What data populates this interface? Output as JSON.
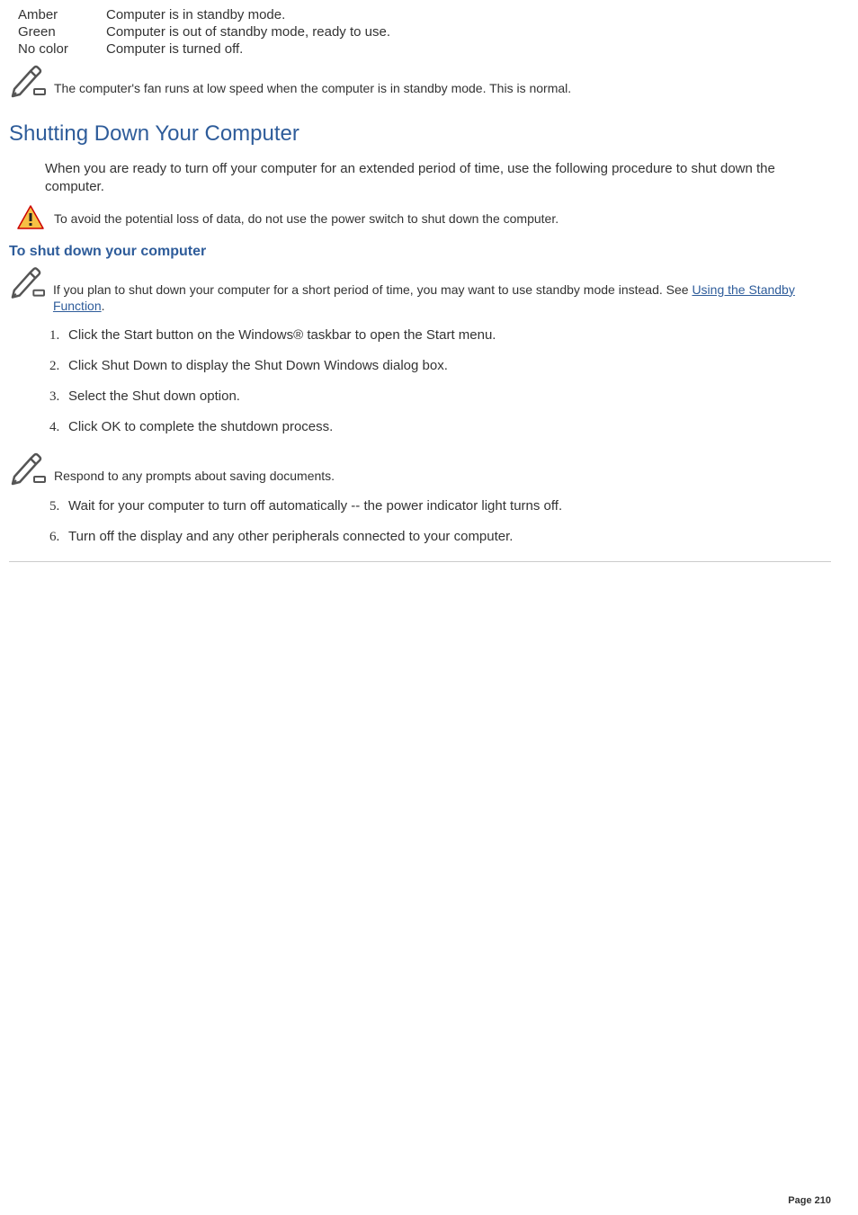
{
  "color_table": [
    {
      "label": "Amber",
      "desc": "Computer is in standby mode."
    },
    {
      "label": "Green",
      "desc": "Computer is out of standby mode, ready to use."
    },
    {
      "label": "No color",
      "desc": "Computer is turned off."
    }
  ],
  "note_top": "The computer's fan runs at low speed when the computer is in standby mode. This is normal.",
  "heading_main": "Shutting Down Your Computer",
  "intro": "When you are ready to turn off your computer for an extended period of time, use the following procedure to shut down the computer.",
  "warning": "To avoid the potential loss of data, do not use the power switch to shut down the computer.",
  "subheading": "To shut down your computer",
  "note_shutdown_a": "If you plan to shut down your computer for a short period of time, you may want to use standby mode instead. See ",
  "note_shutdown_link": "Using the Standby Function",
  "note_shutdown_b": ".",
  "steps_1_4": [
    "Click the Start button on the Windows® taskbar to open the Start menu.",
    "Click Shut Down to display the Shut Down Windows dialog box.",
    "Select the Shut down option.",
    "Click OK to complete the shutdown process."
  ],
  "note_mid": "Respond to any prompts about saving documents.",
  "steps_5_6": [
    "Wait for your computer to turn off automatically -- the power indicator light turns off.",
    "Turn off the display and any other peripherals connected to your computer."
  ],
  "page_number": "Page 210"
}
